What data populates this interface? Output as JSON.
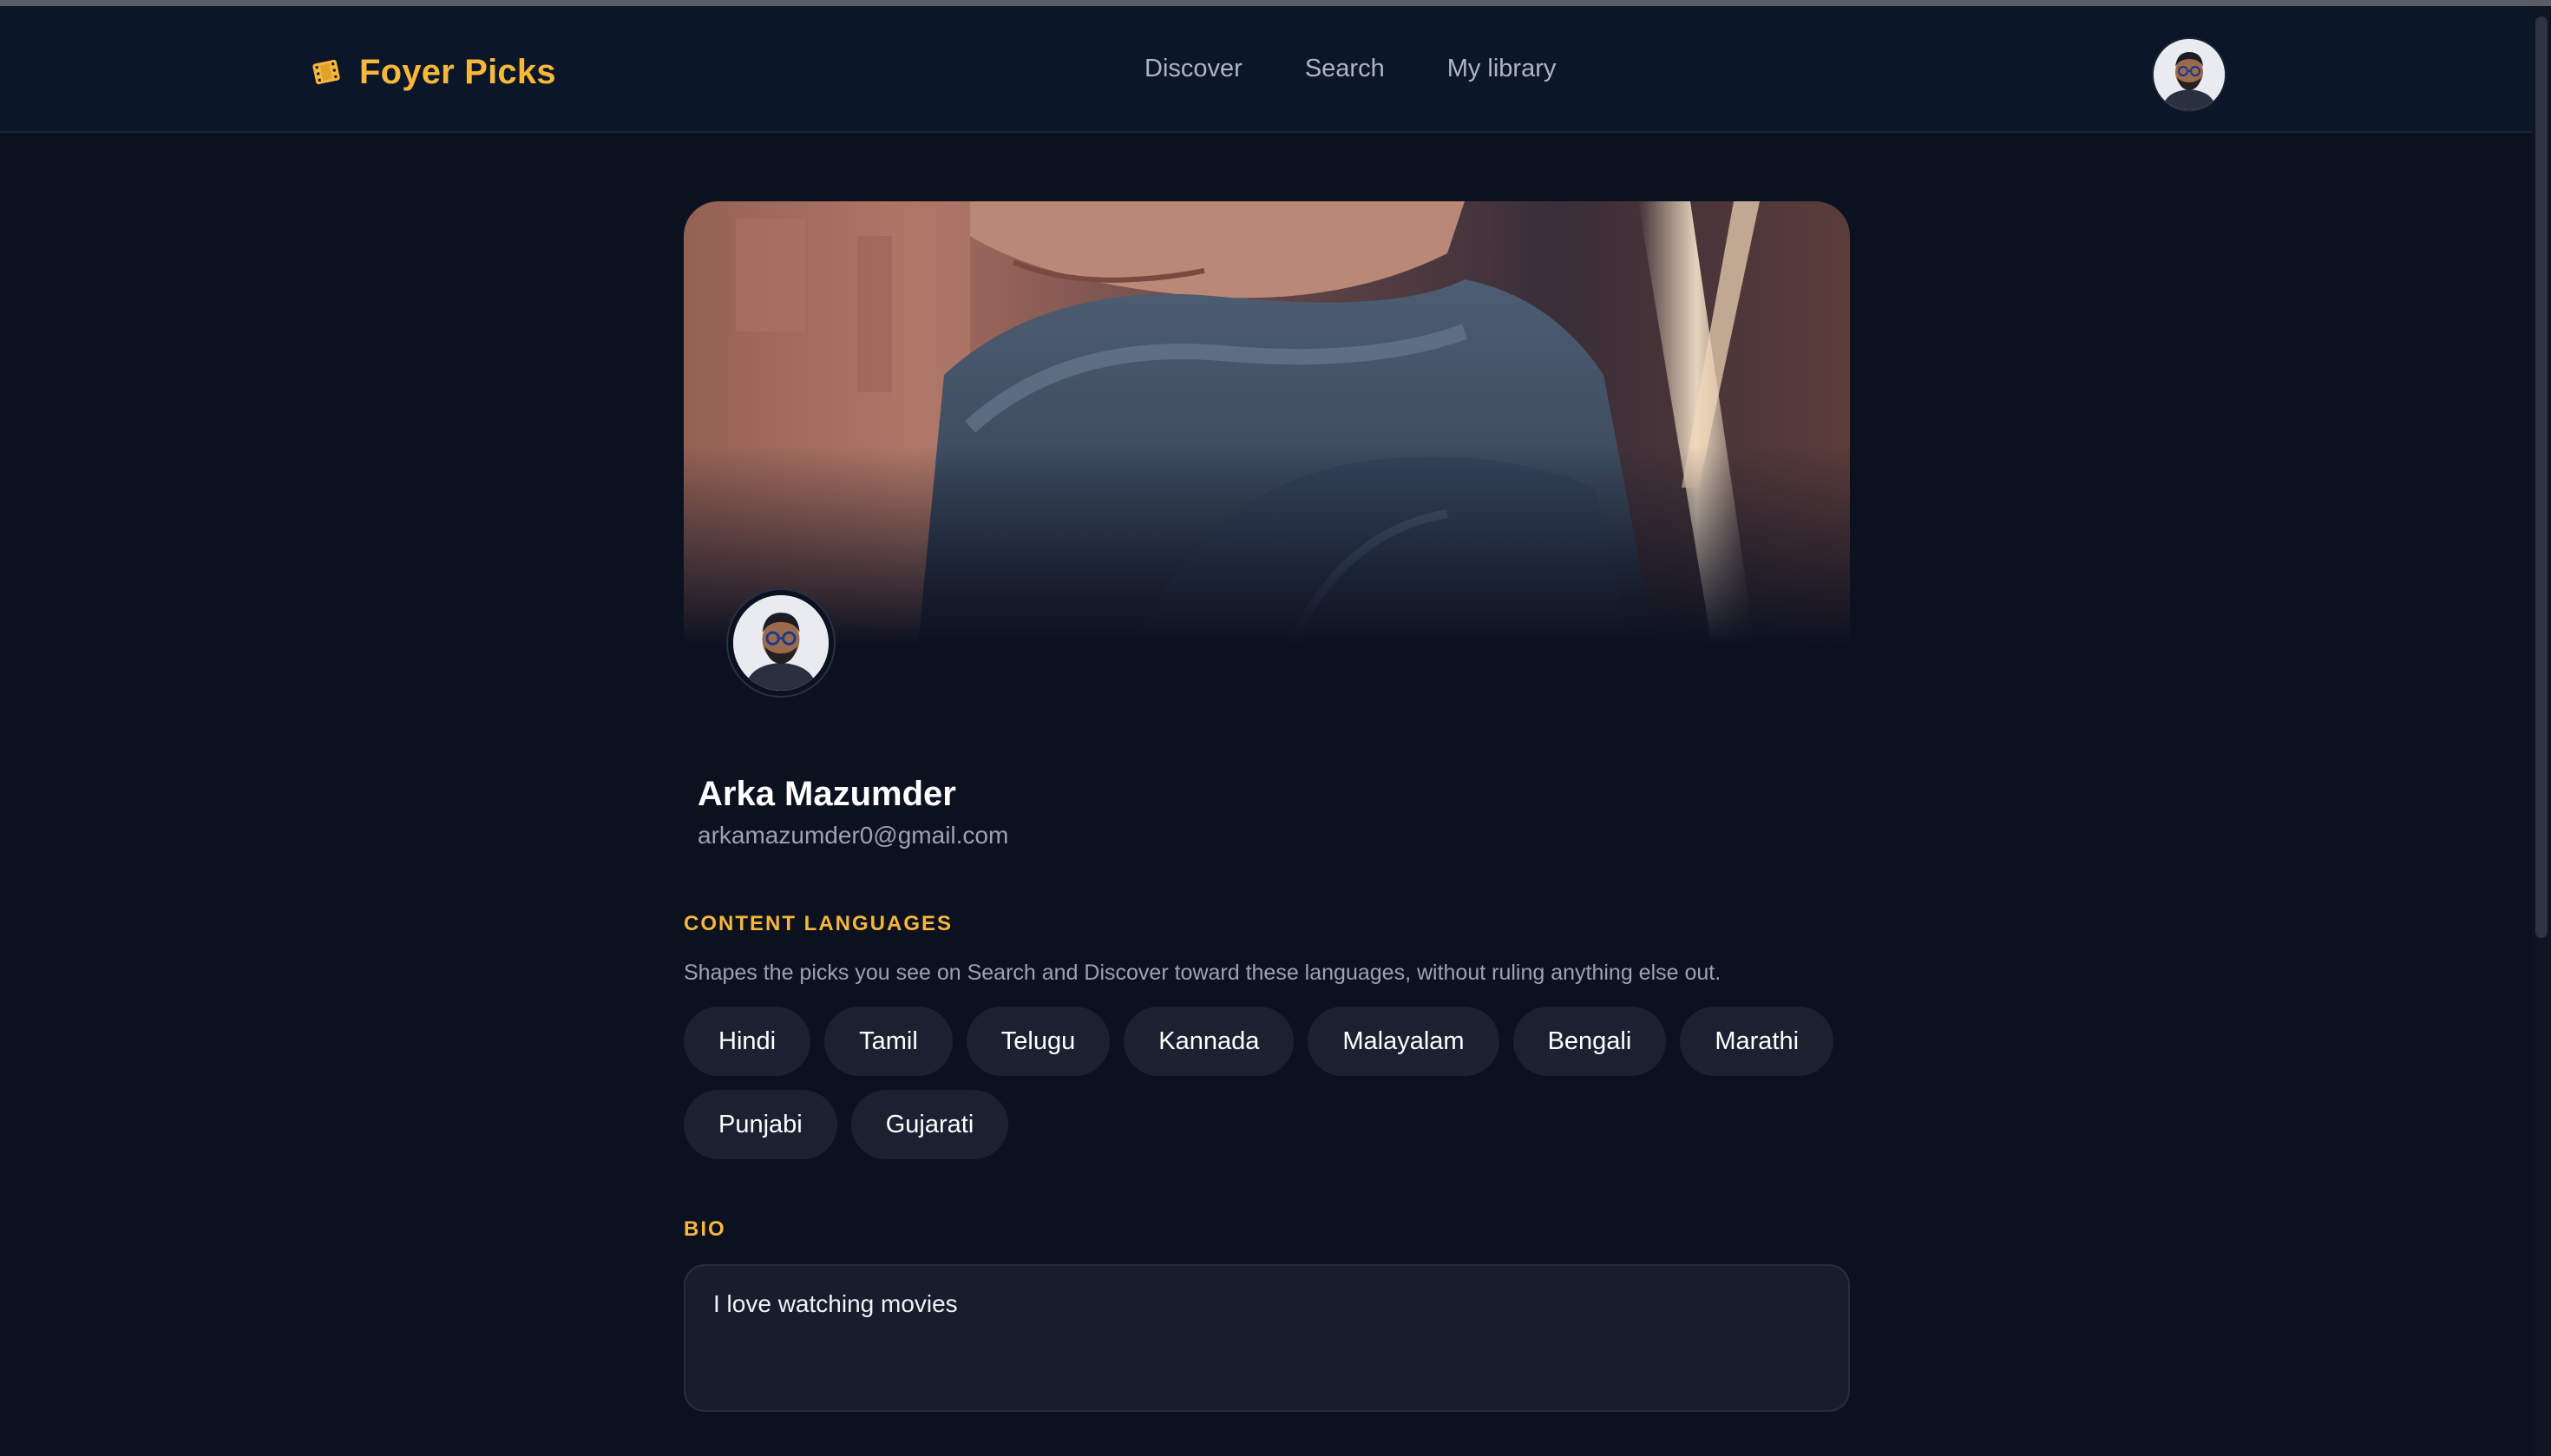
{
  "app": {
    "brand_name": "Foyer Picks",
    "brand_icon": "film-icon",
    "accent_color": "#f6b73c"
  },
  "nav": {
    "links": [
      {
        "label": "Discover"
      },
      {
        "label": "Search"
      },
      {
        "label": "My library"
      }
    ],
    "avatar_icon": "user-avatar"
  },
  "profile": {
    "name": "Arka Mazumder",
    "email": "arkamazumder0@gmail.com",
    "cover_image": "movie-still-cover",
    "avatar_icon": "user-avatar"
  },
  "content_languages": {
    "label": "CONTENT LANGUAGES",
    "hint": "Shapes the picks you see on Search and Discover toward these languages, without ruling anything else out.",
    "options": [
      "Hindi",
      "Tamil",
      "Telugu",
      "Kannada",
      "Malayalam",
      "Bengali",
      "Marathi",
      "Punjabi",
      "Gujarati"
    ]
  },
  "bio": {
    "label": "BIO",
    "value": "I love watching movies"
  }
}
